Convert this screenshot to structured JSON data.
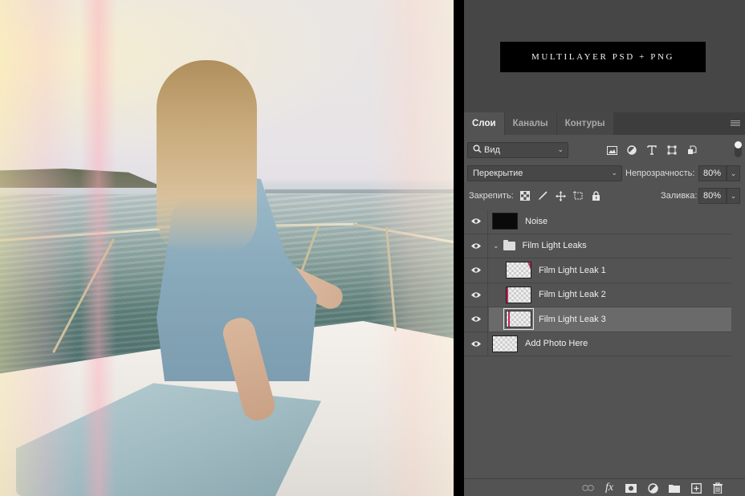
{
  "canvas": {
    "description": "Photo of a woman in a light blue dress sitting on the bow of a white boat on the water, with pink/yellow film light leak overlays"
  },
  "banner": {
    "text": "MULTILAYER PSD + PNG"
  },
  "layers_panel": {
    "tabs": [
      {
        "label": "Слои",
        "active": true
      },
      {
        "label": "Каналы",
        "active": false
      },
      {
        "label": "Контуры",
        "active": false
      }
    ],
    "menu_icon": "panel-menu-icon",
    "filter": {
      "kind_label": "Вид",
      "icons": [
        "image-filter-icon",
        "adjustment-filter-icon",
        "type-filter-icon",
        "shape-filter-icon",
        "smart-object-filter-icon"
      ],
      "filter_toggle": "on"
    },
    "blend_mode": "Перекрытие",
    "opacity_label": "Непрозрачность:",
    "opacity_value": "80%",
    "lock_label": "Закрепить:",
    "lock_icons": [
      "lock-transparent-pixels-icon",
      "lock-image-pixels-icon",
      "lock-position-icon",
      "lock-artboard-icon",
      "lock-all-icon"
    ],
    "fill_label": "Заливка:",
    "fill_value": "80%",
    "layers": [
      {
        "name": "Noise",
        "type": "layer",
        "visible": true,
        "thumb": "black",
        "indent": 0,
        "selected": false
      },
      {
        "name": "Film Light Leaks",
        "type": "group",
        "visible": true,
        "expanded": true,
        "indent": 0,
        "selected": false
      },
      {
        "name": "Film Light Leak 1",
        "type": "layer",
        "visible": true,
        "thumb": "leak-corner",
        "indent": 1,
        "selected": false
      },
      {
        "name": "Film Light Leak 2",
        "type": "layer",
        "visible": true,
        "thumb": "leak-left",
        "indent": 1,
        "selected": false
      },
      {
        "name": "Film Light Leak 3",
        "type": "layer",
        "visible": true,
        "thumb": "leak-left-selected",
        "indent": 1,
        "selected": true
      },
      {
        "name": "Add Photo Here",
        "type": "layer",
        "visible": true,
        "thumb": "transparent",
        "indent": 0,
        "selected": false
      }
    ],
    "footer_icons": [
      "link-layers-icon",
      "layer-style-fx-icon",
      "add-mask-icon",
      "adjustment-layer-icon",
      "new-group-icon",
      "new-layer-icon",
      "delete-layer-icon"
    ]
  },
  "glyphs": {
    "chevron": "⌄",
    "fx": "fx",
    "plus": "+"
  }
}
